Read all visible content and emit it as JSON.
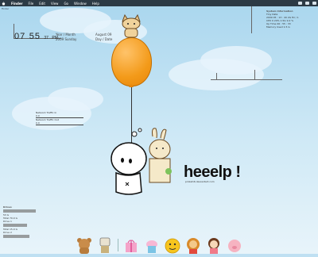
{
  "menubar": {
    "app": "Finder",
    "items": [
      "File",
      "Edit",
      "View",
      "Go",
      "Window",
      "Help"
    ]
  },
  "desktop": {
    "label": "Finder"
  },
  "clock": {
    "hours": "07",
    "minutes": "55",
    "seconds": "37",
    "ampm": "PM"
  },
  "date_widget": {
    "year_month": "Year / Month",
    "year_day": "2009 Sunday",
    "month": "August 09",
    "day": "Day / Date"
  },
  "system_panel": {
    "title": "System Information",
    "subtitle": "Tiny Data",
    "lines": [
      "2009 05 : 13 : 40   2G Hz / 1",
      "CPU 0   20% 1.5G   9.2 %",
      "Up Time 06 : 55 : 33",
      "Memory Used 1.5 G"
    ]
  },
  "network_panel": {
    "in_label": "Network Traffic In",
    "in_value": "0.0",
    "out_label": "Network Traffic Out",
    "out_value": "0.0"
  },
  "disk_panel": {
    "title": "Drives",
    "drives": [
      {
        "name": "Drive 0",
        "used": "53 G",
        "total": "Total   70.0 G",
        "fill": 0.75
      },
      {
        "name": "Drive 1",
        "used": "8.1 G",
        "total": "Total   15.0 G",
        "fill": 0.55
      },
      {
        "name": "Drive 2",
        "used": "12.2 G",
        "total": "Total   20.0 G",
        "fill": 0.6
      }
    ]
  },
  "illustration": {
    "caption": "heeelp !",
    "credit": "pinkal16.deviantart.com"
  },
  "dock": {
    "items": [
      "bear",
      "robot",
      "pink-gift",
      "cupcake",
      "smiley",
      "lion",
      "girl",
      "pig"
    ]
  },
  "colors": {
    "balloon": "#f39a19",
    "menubar": "#2c3a45",
    "sky": "#bfe0f2"
  }
}
